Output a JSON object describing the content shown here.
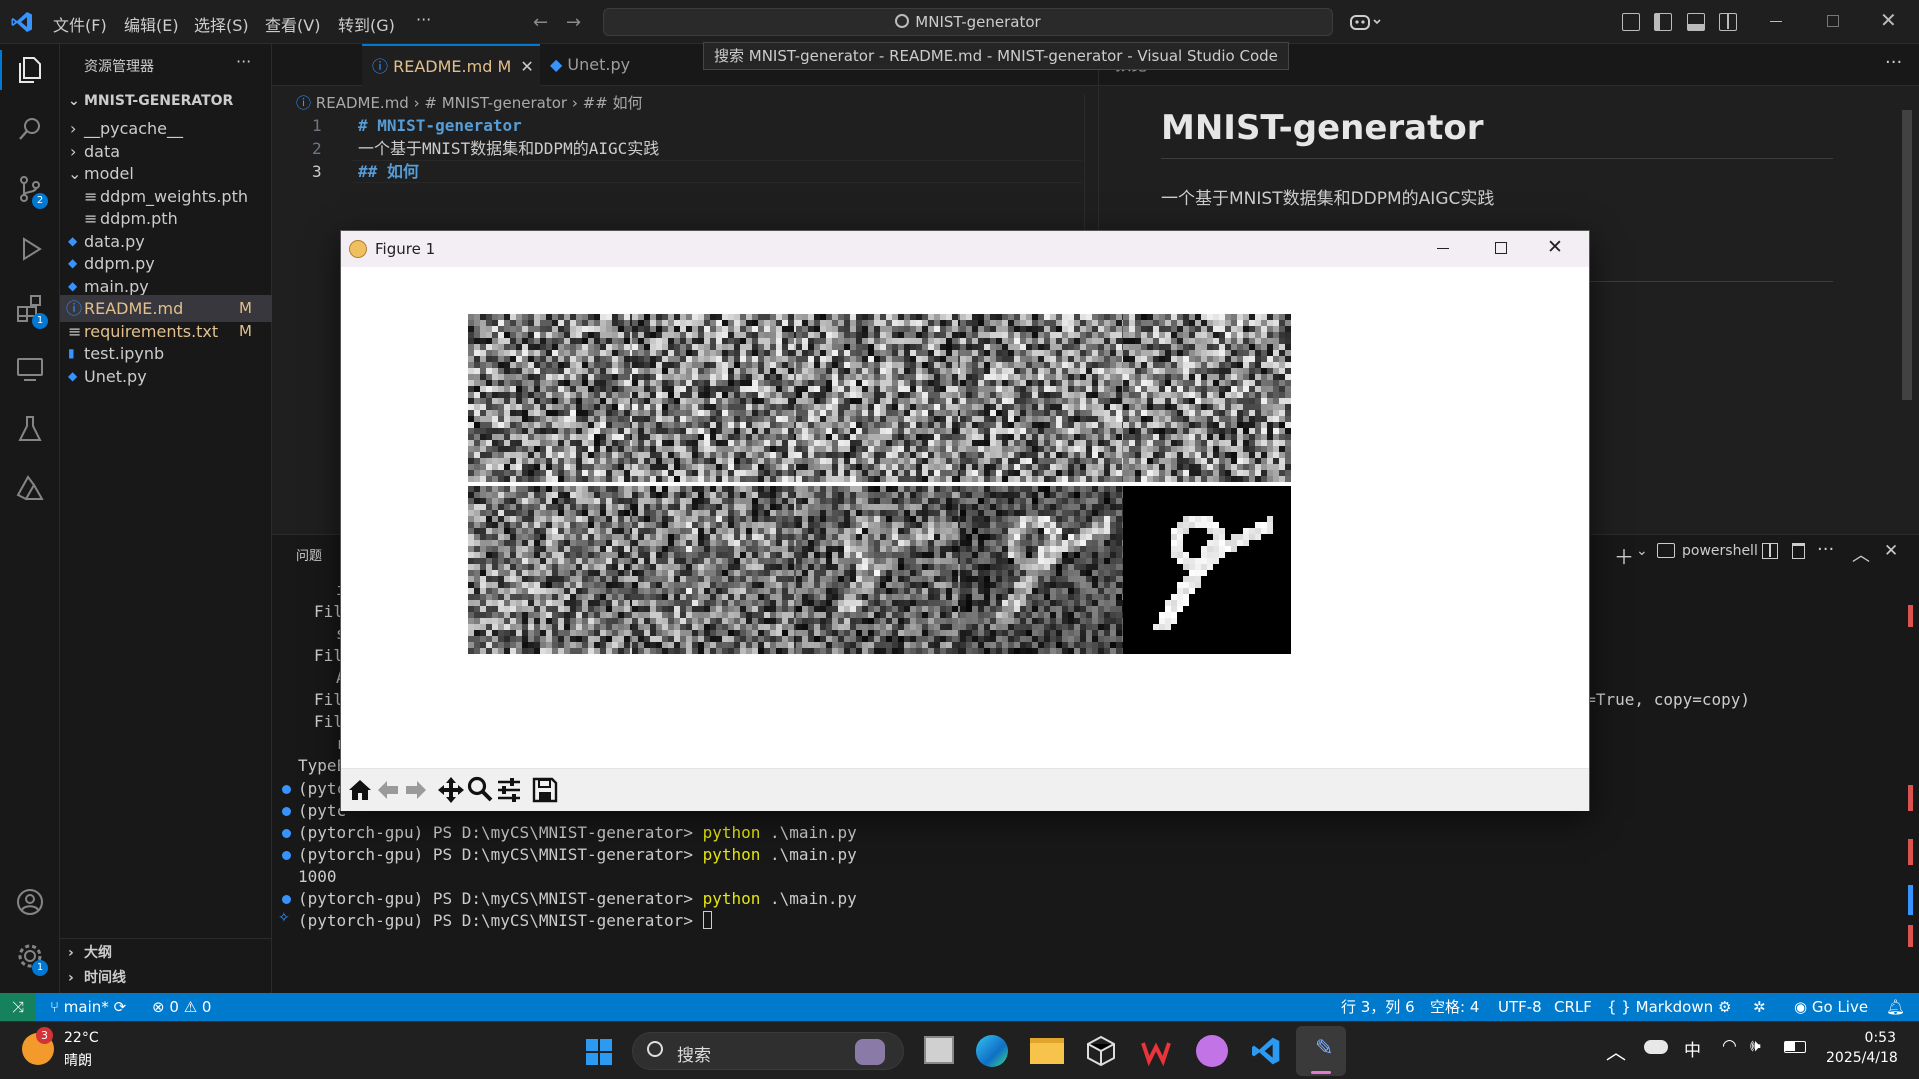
{
  "titlebar": {
    "menus": [
      "文件(F)",
      "编辑(E)",
      "选择(S)",
      "查看(V)",
      "转到(G)",
      "···"
    ],
    "search_text": "MNIST-generator",
    "window_tooltip": "搜索 MNIST-generator - README.md - MNIST-generator - Visual Studio Code"
  },
  "activity": {
    "scm_badge": "2",
    "extensions_badge": "1",
    "settings_badge": "1"
  },
  "sidebar": {
    "header": "资源管理器",
    "more": "···",
    "root": "MNIST-GENERATOR",
    "items": [
      {
        "label": "__pycache__",
        "type": "folder"
      },
      {
        "label": "data",
        "type": "folder"
      },
      {
        "label": "model",
        "type": "folder-open"
      },
      {
        "label": "ddpm_weights.pth",
        "type": "file"
      },
      {
        "label": "ddpm.pth",
        "type": "file"
      },
      {
        "label": "data.py",
        "type": "py"
      },
      {
        "label": "ddpm.py",
        "type": "py"
      },
      {
        "label": "main.py",
        "type": "py"
      },
      {
        "label": "README.md",
        "type": "md",
        "git": "M"
      },
      {
        "label": "requirements.txt",
        "type": "txt",
        "git": "M"
      },
      {
        "label": "test.ipynb",
        "type": "ipynb"
      },
      {
        "label": "Unet.py",
        "type": "py"
      }
    ],
    "outline": "大纲",
    "timeline": "时间线"
  },
  "editor": {
    "tabs": [
      {
        "label": "README.md",
        "mod": "M"
      },
      {
        "label": "Unet.py"
      }
    ],
    "breadcrumb": [
      "README.md",
      "# MNIST-generator",
      "## 如何"
    ],
    "lines": [
      {
        "num": "1",
        "text": "# MNIST-generator"
      },
      {
        "num": "2",
        "text": "一个基于MNIST数据集和DDPM的AIGC实践"
      },
      {
        "num": "3",
        "text": "## 如何"
      }
    ]
  },
  "preview": {
    "tab_label": "预览 README.md",
    "h1": "MNIST-generator",
    "p": "一个基于MNIST数据集和DDPM的AIGC实践"
  },
  "figure": {
    "title": "Figure 1"
  },
  "panel": {
    "tab_problems": "问题",
    "terminal_name": "powershell",
    "partial_lines": [
      "i",
      "Fil",
      "s",
      "Fil",
      "A",
      "Fil",
      "Fil",
      "r",
      "TypeE"
    ],
    "right_fragment": "ok=True, copy=copy)",
    "prompt": "(pytorch-gpu) PS D:\\myCS\\MNIST-generator>",
    "cmd_python": "python",
    "cmd_arg": ".\\main.py",
    "output_1000": "1000",
    "partial_prompt": "(pytc"
  },
  "statusbar": {
    "branch": "main*",
    "errors": "0",
    "warnings": "0",
    "position": "行 3，列 6",
    "spaces": "空格: 4",
    "encoding": "UTF-8",
    "eol": "CRLF",
    "language": "Markdown",
    "golive": "Go Live"
  },
  "taskbar": {
    "weather_temp": "22°C",
    "weather_desc": "晴朗",
    "weather_badge": "3",
    "search_label": "搜索",
    "ime": "中",
    "time": "0:53",
    "date": "2025/4/18"
  },
  "colors": {
    "accent": "#007acc",
    "git_modified": "#e2c08d",
    "md_heading": "#569cd6",
    "py_icon": "#3794ff"
  }
}
